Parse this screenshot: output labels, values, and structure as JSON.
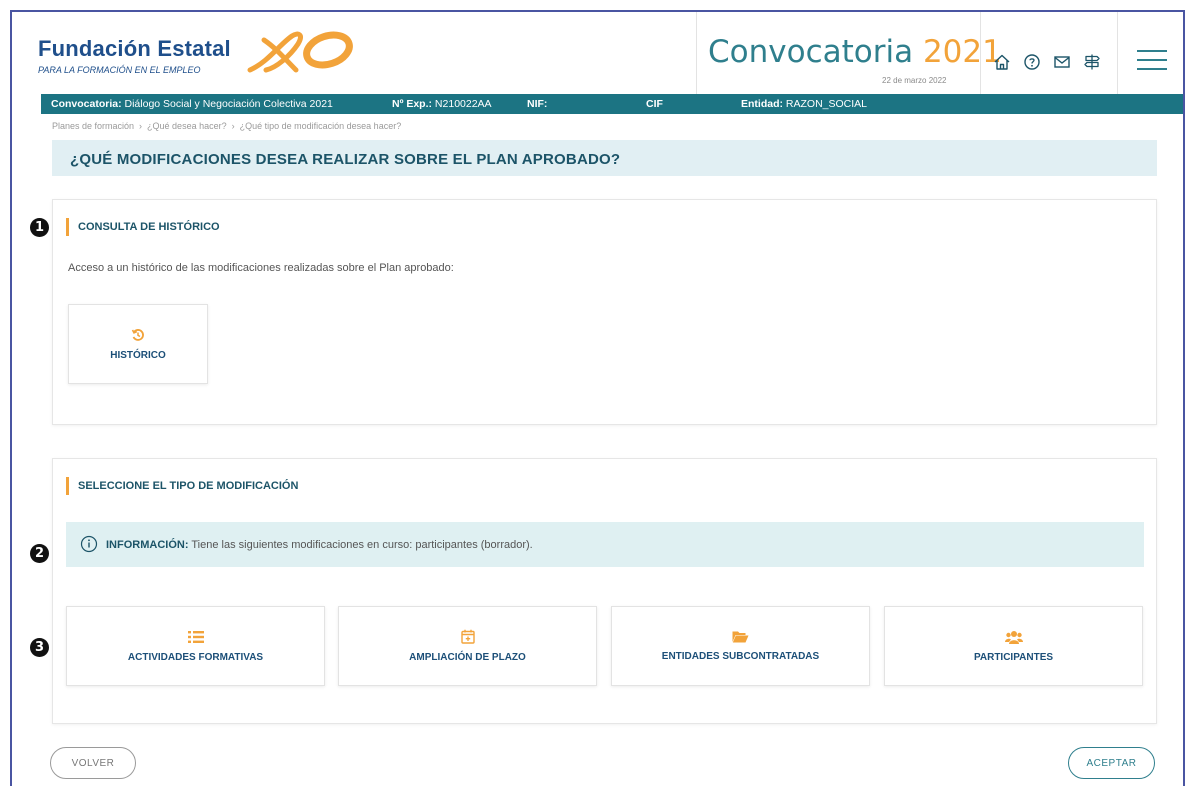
{
  "header": {
    "logo_title": "Fundación Estatal",
    "logo_subtitle": "PARA LA FORMACIÓN EN EL EMPLEO",
    "convocatoria_word": "Convocatoria ",
    "convocatoria_year": "2021",
    "date": "22 de marzo 2022",
    "icons": [
      "home-icon",
      "help-icon",
      "mail-icon",
      "signpost-icon",
      "menu-icon"
    ]
  },
  "infobar": {
    "convocatoria_label": "Convocatoria:",
    "convocatoria_value": " Diálogo Social y Negociación Colectiva 2021",
    "exp_label": "Nº Exp.:",
    "exp_value": " N210022AA",
    "nif_label": "NIF:",
    "cif_label": "CIF",
    "entidad_label": "Entidad:",
    "entidad_value": " RAZON_SOCIAL"
  },
  "breadcrumb": [
    "Planes de formación",
    "¿Qué desea hacer?",
    "¿Qué tipo de modificación desea hacer?"
  ],
  "page_title": "¿QUÉ MODIFICACIONES DESEA REALIZAR SOBRE EL PLAN APROBADO?",
  "historico": {
    "title": "CONSULTA DE HISTÓRICO",
    "description": "Acceso a un histórico de las modificaciones realizadas sobre el Plan aprobado:",
    "button_label": "HISTÓRICO"
  },
  "modificacion": {
    "title": "SELECCIONE EL TIPO DE MODIFICACIÓN",
    "info_label": "INFORMACIÓN:",
    "info_text": " Tiene las siguientes modificaciones en curso: participantes (borrador).",
    "cards": [
      {
        "label": "ACTIVIDADES FORMATIVAS",
        "icon": "list-icon"
      },
      {
        "label": "AMPLIACIÓN DE PLAZO",
        "icon": "calendar-plus-icon"
      },
      {
        "label": "ENTIDADES SUBCONTRATADAS",
        "icon": "folder-open-icon"
      },
      {
        "label": "PARTICIPANTES",
        "icon": "users-icon"
      }
    ]
  },
  "markers": [
    "1",
    "2",
    "3"
  ],
  "footer": {
    "back_label": "VOLVER",
    "accept_label": "ACEPTAR"
  },
  "colors": {
    "accent": "#f2a33a",
    "teal": "#1c7483",
    "navy": "#1f4f8b",
    "title_bg": "#e1eff3",
    "info_bg": "#dff0f2"
  }
}
